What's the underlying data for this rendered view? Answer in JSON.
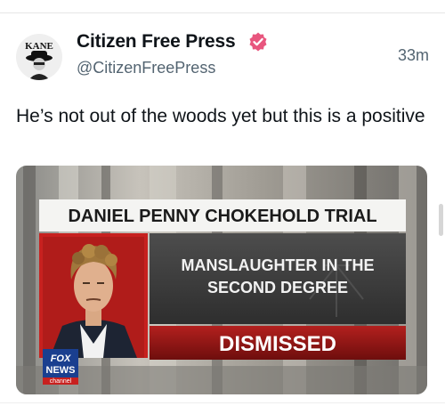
{
  "tweet": {
    "author_name": "Citizen Free Press",
    "handle": "@CitizenFreePress",
    "timestamp": "33m",
    "text": "He’s not out of the woods yet but this is a positive",
    "avatar_text": "KANE",
    "verified": true,
    "verified_color": "#e8567e"
  },
  "media": {
    "headline": "DANIEL PENNY CHOKEHOLD TRIAL",
    "charge_line1": "MANSLAUGHTER IN THE",
    "charge_line2": "SECOND DEGREE",
    "status": "DISMISSED",
    "network_logo_line1": "FOX",
    "network_logo_line2": "NEWS",
    "network_logo_line3": "channel"
  }
}
